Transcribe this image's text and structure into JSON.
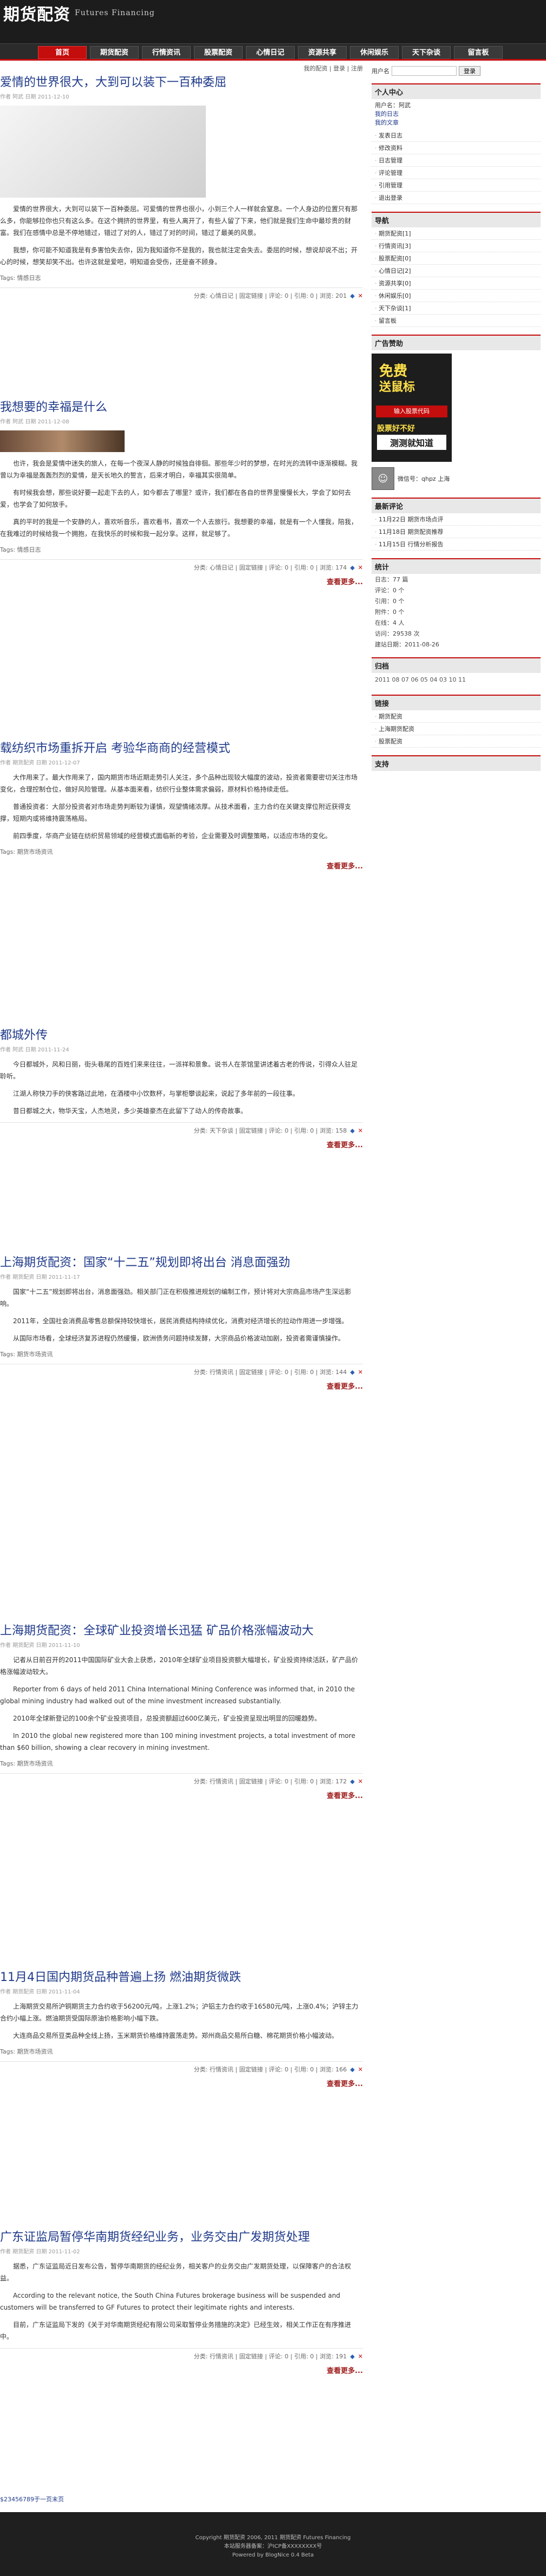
{
  "header": {
    "logo_cn": "期货配资",
    "logo_en": "Futures Financing"
  },
  "nav": [
    {
      "label": "首页",
      "active": true
    },
    {
      "label": "期货配资"
    },
    {
      "label": "行情资讯"
    },
    {
      "label": "股票配资"
    },
    {
      "label": "心情日记"
    },
    {
      "label": "资源共享"
    },
    {
      "label": "休闲娱乐"
    },
    {
      "label": "天下杂谈"
    },
    {
      "label": "留言板"
    }
  ],
  "toplinks": "我的配资 | 登录 | 注册",
  "posts": [
    {
      "title": "爱情的世界很大，大到可以装下一百种委屈",
      "meta": "作者 阿武 日期 2011-12-10",
      "body": [
        "爱情的世界很大，大到可以装下一百种委屈。可爱情的世界也很小，小到三个人一样就会窒息。一个人身边的位置只有那么多，你能够拉你也只有这么多。在这个拥挤的世界里，有些人离开了，有些人留了下来，他们就是我们生命中最珍贵的财富。我们在感情中总是不停地错过，错过了对的人，错过了对的时间，错过了最美的风景。",
        "我想，你可能不知道我是有多害怕失去你，因为我知道你不是我的，我也就注定会失去。委屈的时候，想说却说不出；开心的时候，想笑却笑不出。也许这就是爱吧，明知道会受伤，还是奋不顾身。"
      ],
      "tags": "Tags: 情感日志",
      "footer": "分类: 心情日记 | 固定链接 | 评论: 0 | 引用: 0 | 浏览: 201"
    },
    {
      "title": "我想要的幸福是什么",
      "meta": "作者 阿武 日期 2011-12-08",
      "body": [
        "也许，我会是爱情中迷失的旅人，在每一个夜深人静的时候独自徘徊。那些年少时的梦想，在时光的流转中逐渐模糊。我曾以为幸福是轰轰烈烈的爱情，是天长地久的誓言，后来才明白，幸福其实很简单。",
        "有时候我会想，那些说好要一起走下去的人，如今都去了哪里？或许，我们都在各自的世界里慢慢长大，学会了如何去爱，也学会了如何放手。",
        "真的平时的我是一个安静的人，喜欢听音乐，喜欢看书，喜欢一个人去旅行。我想要的幸福，就是有一个人懂我，陪我，在我难过的时候给我一个拥抱，在我快乐的时候和我一起分享。这样，就足够了。"
      ],
      "tags": "Tags: 情感日志",
      "footer": "分类: 心情日记 | 固定链接 | 评论: 0 | 引用: 0 | 浏览: 174"
    },
    {
      "title": "载纺织市场重拆开启 考验华商商的经营模式",
      "meta": "作者 期货配资 日期 2011-12-07",
      "body": [
        "大作用来了。最大作用来了，国内期货市场近期走势引人关注，多个品种出现较大幅度的波动，投资者需要密切关注市场变化，合理控制仓位，做好风险管理。从基本面来看，纺织行业整体需求偏弱，原材料价格持续走低。",
        "普通投资者：大部分投资者对市场走势判断较为谨慎，观望情绪浓厚。从技术面看，主力合约在关键支撑位附近获得支撑，短期内或将维持震荡格局。",
        "前四季度，华商产业链在纺织贸易领域的经营模式面临新的考验，企业需要及时调整策略，以适应市场的变化。"
      ],
      "tags": "Tags: 期货市场资讯",
      "footer": ""
    },
    {
      "title": "都城外传",
      "meta": "作者 阿武 日期 2011-11-24",
      "body": [
        "今日都城外，风和日丽，街头巷尾的百姓们来来往往，一派祥和景象。说书人在茶馆里讲述着古老的传说，引得众人驻足聆听。",
        "江湖人称快刀手的侠客路过此地，在酒楼中小饮数杯，与掌柜攀谈起来，说起了多年前的一段往事。",
        "昔日都城之大，物华天宝，人杰地灵，多少英雄豪杰在此留下了动人的传奇故事。"
      ],
      "tags": "",
      "footer": "分类: 天下杂谈 | 固定链接 | 评论: 0 | 引用: 0 | 浏览: 158"
    },
    {
      "title": "上海期货配资：国家“十二五”规划即将出台 消息面强劲",
      "meta": "作者 期货配资 日期 2011-11-17",
      "body": [
        "国家“十二五”规划即将出台，消息面强劲。相关部门正在积极推进规划的编制工作，预计将对大宗商品市场产生深远影响。",
        "2011年，全国社会消费品零售总额保持较快增长，居民消费结构持续优化，消费对经济增长的拉动作用进一步增强。",
        "从国际市场看，全球经济复苏进程仍然缓慢，欧洲债务问题持续发酵，大宗商品价格波动加剧，投资者需谨慎操作。"
      ],
      "tags": "Tags: 期货市场资讯",
      "footer": "分类: 行情资讯 | 固定链接 | 评论: 0 | 引用: 0 | 浏览: 144"
    },
    {
      "title": "上海期货配资：全球矿业投资增长迅猛 矿品价格涨幅波动大",
      "meta": "作者 期货配资 日期 2011-11-10",
      "body": [
        "记者从日前召开的2011中国国际矿业大会上获悉，2010年全球矿业项目投资额大幅增长，矿业投资持续活跃，矿产品价格涨幅波动较大。",
        "Reporter from 6 days of held 2011 China International Mining Conference was informed that, in 2010 the global mining industry had walked out of the mine investment increased substantially.",
        "2010年全球新登记的100余个矿业投资项目，总投资额超过600亿美元，矿业投资呈现出明显的回暖趋势。",
        "In 2010 the global new registered more than 100 mining investment projects, a total investment of more than $60 billion, showing a clear recovery in mining investment."
      ],
      "tags": "Tags: 期货市场资讯",
      "footer": "分类: 行情资讯 | 固定链接 | 评论: 0 | 引用: 0 | 浏览: 172"
    },
    {
      "title": "11月4日国内期货品种普遍上扬 燃油期货微跌",
      "meta": "作者 期货配资 日期 2011-11-04",
      "body": [
        "上海期货交易所沪铜期货主力合约收于56200元/吨，上涨1.2%；沪铝主力合约收于16580元/吨，上涨0.4%；沪锌主力合约小幅上涨。燃油期货受国际原油价格影响小幅下跌。",
        "大连商品交易所豆类品种全线上扬，玉米期货价格维持震荡走势。郑州商品交易所白糖、棉花期货价格小幅波动。"
      ],
      "tags": "Tags: 期货市场资讯",
      "footer": "分类: 行情资讯 | 固定链接 | 评论: 0 | 引用: 0 | 浏览: 166"
    },
    {
      "title": "广东证监局暂停华南期货经纪业务，业务交由广发期货处理",
      "meta": "作者 期货配资 日期 2011-11-02",
      "body": [
        "据悉，广东证监局近日发布公告，暂停华南期货的经纪业务，相关客户的业务交由广发期货处理，以保障客户的合法权益。",
        "According to the relevant notice, the South China Futures brokerage business will be suspended and customers will be transferred to GF Futures to protect their legitimate rights and interests.",
        "目前，广东证监局下发的《关于对华南期货经纪有限公司采取暂停业务措施的决定》已经生效，相关工作正在有序推进中。"
      ],
      "tags": "",
      "footer": "分类: 行情资讯 | 固定链接 | 评论: 0 | 引用: 0 | 浏览: 191"
    }
  ],
  "readmore": "查看更多...",
  "sidebar": {
    "login_label": "用户名",
    "login_btn": "登录",
    "person_title": "个人中心",
    "person_lines": [
      "用户名：阿武",
      "我的日志",
      "我的文章"
    ],
    "person_menu": [
      "发表日志",
      "修改资料",
      "日志管理",
      "评论管理",
      "引用管理",
      "退出登录"
    ],
    "nav_title": "导航",
    "nav_items": [
      "期货配资[1]",
      "行情资讯[3]",
      "股票配资[0]",
      "心情日记[2]",
      "资源共享[0]",
      "休闲娱乐[0]",
      "天下杂谈[1]",
      "留言板"
    ],
    "ad_title": "广告赞助",
    "ad_text1": "免费",
    "ad_text2": "送鼠标",
    "ad_btn": "输入股票代码",
    "ad_text3": "股票好不好",
    "ad_text4": "测测就知道",
    "contact": "微信号：qhpz 上海",
    "recent_title": "最新评论",
    "recent": [
      "11月22日 期货市场点评",
      "11月18日 期货配资推荐",
      "11月15日 行情分析报告"
    ],
    "stats_title": "统计",
    "stats": [
      "日志：77 篇",
      "评论：0 个",
      "引用：0 个",
      "附件：0 个",
      "在线：4 人",
      "访问：29538 次",
      "建站日期：2011-08-26"
    ],
    "archive_title": "归档",
    "archive": "2011 08 07 06 05 04 03 10 11",
    "links_title": "链接",
    "links": [
      "期货配资",
      "上海期货配资",
      "股票配资"
    ],
    "support_title": "支持"
  },
  "footer": {
    "line1": "Copyright 期货配资 2006, 2011 期货配资 Futures Financing",
    "line2": "本站服务器备案：沪ICP备XXXXXXXX号",
    "line3": "Powered by BlogNice 0.4 Beta"
  },
  "footer_tag": "$23456789于一页末页"
}
